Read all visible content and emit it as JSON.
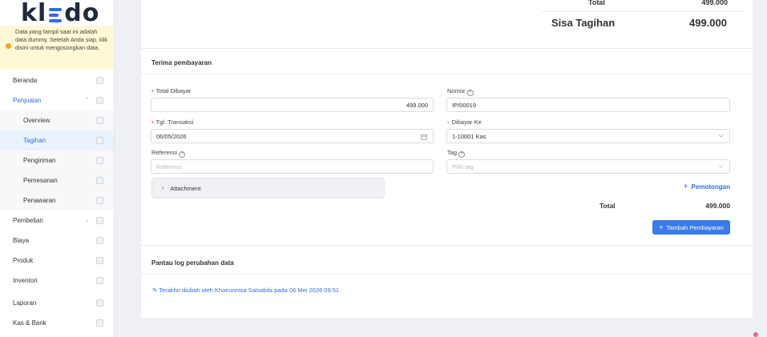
{
  "logo": {
    "left": "kl",
    "right": "do"
  },
  "notice": {
    "text": "Data yang tampil saat ini adalah data dummy. Setelah Anda siap, klik disini untuk mengosongkan data."
  },
  "sidebar": {
    "items": [
      {
        "label": "Beranda",
        "icon": "home-icon"
      },
      {
        "label": "Penjualan",
        "icon": "shopping-bag-icon"
      },
      {
        "label": "Overview",
        "icon": "chart-icon"
      },
      {
        "label": "Tagihan",
        "icon": "invoice-icon"
      },
      {
        "label": "Pengiriman",
        "icon": "truck-icon"
      },
      {
        "label": "Pemesanan",
        "icon": "order-icon"
      },
      {
        "label": "Penawaran",
        "icon": "quote-icon"
      },
      {
        "label": "Pembelian",
        "icon": "cart-icon"
      },
      {
        "label": "Biaya",
        "icon": "wallet-icon"
      },
      {
        "label": "Produk",
        "icon": "box-icon"
      },
      {
        "label": "Inventori",
        "icon": "warehouse-icon"
      },
      {
        "label": "Laporan",
        "icon": "report-icon"
      },
      {
        "label": "Kas & Bank",
        "icon": "money-icon"
      }
    ]
  },
  "summary": {
    "total_label": "Total",
    "total_value": "499.000",
    "sisa_label": "Sisa Tagihan",
    "sisa_value": "499.000"
  },
  "payment": {
    "title": "Terima pembayaran",
    "total_dibayar_label": "Total Dibayar",
    "total_dibayar_value": "499.000",
    "nomor_label": "Nomor",
    "nomor_value": "IP/00019",
    "tgl_label": "Tgl. Transaksi",
    "tgl_value": "06/05/2026",
    "dibayar_ke_label": "Dibayar Ke",
    "dibayar_ke_value": "1-10001 Kas",
    "referensi_label": "Referensi",
    "referensi_placeholder": "Referensi",
    "tag_label": "Tag",
    "tag_placeholder": "Pilih tag",
    "attachment_label": "Attachment",
    "potongan_label": "Pemotongan",
    "total_label": "Total",
    "total_value": "499.000",
    "add_button": "Tambah Pembayaran"
  },
  "log": {
    "title": "Pantau log perubahan data",
    "last_edit": "Terakhir diubah oleh Khoirunnisa Salsabila pada 06 Mei 2026 09:51"
  },
  "colors": {
    "accent": "#2f6fe4",
    "primary_button": "#3b7be8",
    "notice_bg": "#fff8d6",
    "required": "#e5484d"
  }
}
